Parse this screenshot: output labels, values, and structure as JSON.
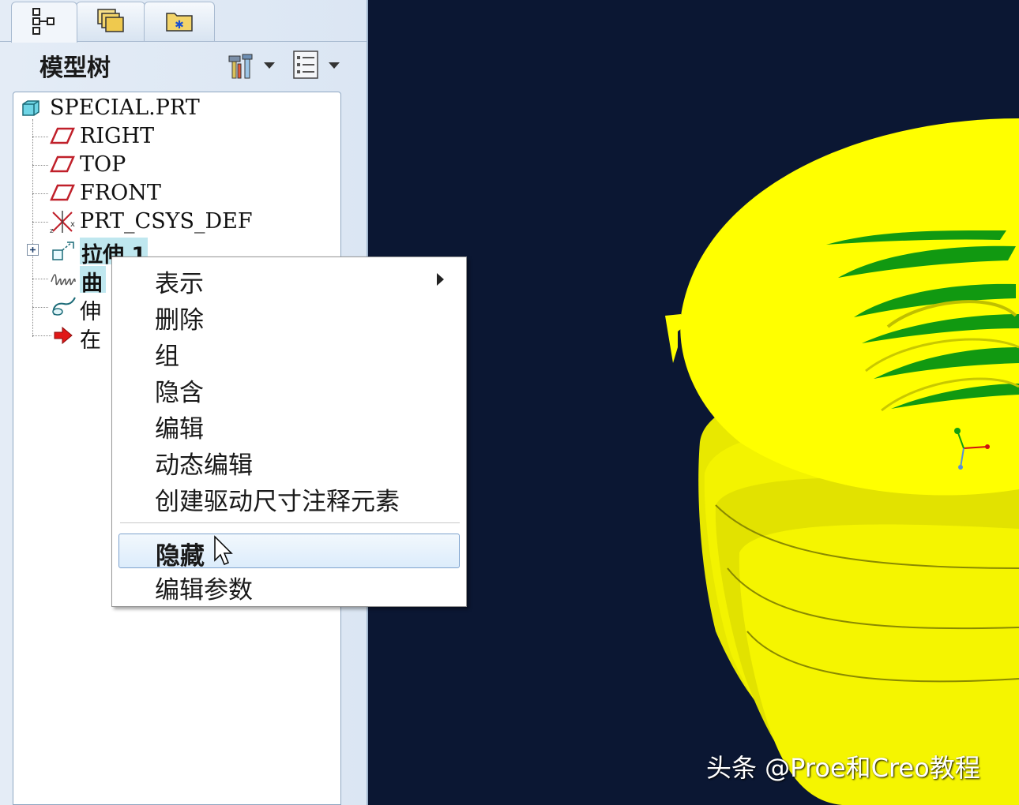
{
  "panel": {
    "tabs": [
      {
        "icon": "model-tree-tab-icon",
        "active": true
      },
      {
        "icon": "folder-browser-tab-icon",
        "active": false
      },
      {
        "icon": "favorites-tab-icon",
        "active": false
      }
    ],
    "title": "模型树",
    "tools_icon": "tree-tools-icon",
    "view_icon": "tree-view-settings-icon"
  },
  "tree": {
    "root": "SPECIAL.PRT",
    "items": [
      {
        "label": "RIGHT",
        "icon": "datum-plane-icon"
      },
      {
        "label": "TOP",
        "icon": "datum-plane-icon"
      },
      {
        "label": "FRONT",
        "icon": "datum-plane-icon"
      },
      {
        "label": "PRT_CSYS_DEF",
        "icon": "coordinate-system-icon"
      },
      {
        "label": "拉伸 1",
        "icon": "extrude-icon",
        "selected": true,
        "expandable": true
      },
      {
        "label": "曲",
        "icon": "helix-curve-icon",
        "selected": true
      },
      {
        "label": "伸",
        "icon": "sweep-icon"
      },
      {
        "label": "在",
        "icon": "insert-here-arrow-icon"
      }
    ]
  },
  "context_menu": {
    "items": [
      "表示",
      "删除",
      "组",
      "隐含",
      "编辑",
      "动态编辑",
      "创建驱动尺寸注释元素"
    ],
    "items_after_separator": [
      "隐藏",
      "编辑参数"
    ],
    "hovered": "隐藏"
  },
  "viewport": {
    "background": "#0b1733",
    "model_color": "#ffff00",
    "cut_color": "#119911"
  },
  "watermark": "头条 @Proe和Creo教程"
}
